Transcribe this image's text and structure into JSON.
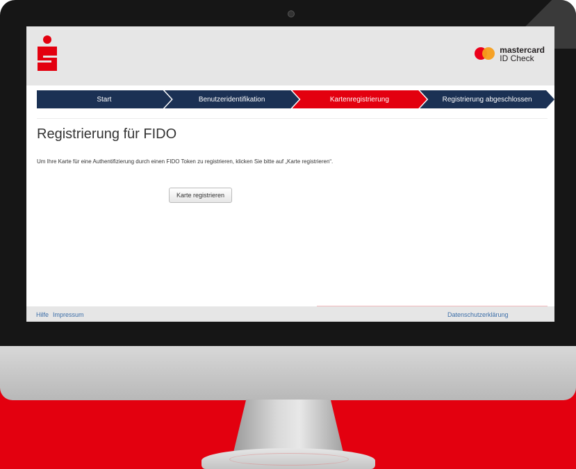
{
  "colors": {
    "brand_red": "#e3000f",
    "step_navy": "#1b3154",
    "link_blue": "#3c6ea8"
  },
  "header": {
    "logo_icon": "sparkasse-s-logo-icon",
    "partner_logo": {
      "icon": "mastercard-circles-icon",
      "brand": "mastercard",
      "subtitle": "ID Check"
    }
  },
  "steps": [
    {
      "label": "Start",
      "active": false
    },
    {
      "label": "Benutzeridentifikation",
      "active": false
    },
    {
      "label": "Kartenregistrierung",
      "active": true
    },
    {
      "label": "Registrierung abgeschlossen",
      "active": false
    }
  ],
  "main": {
    "title": "Registrierung für FIDO",
    "description": "Um Ihre Karte für eine Authentifizierung durch einen FIDO Token zu registrieren, klicken Sie bitte auf „Karte registrieren“.",
    "register_button_label": "Karte registrieren"
  },
  "footer": {
    "help_link": "Hilfe",
    "imprint_link": "Impressum",
    "privacy_link": "Datenschutzerklärung"
  }
}
